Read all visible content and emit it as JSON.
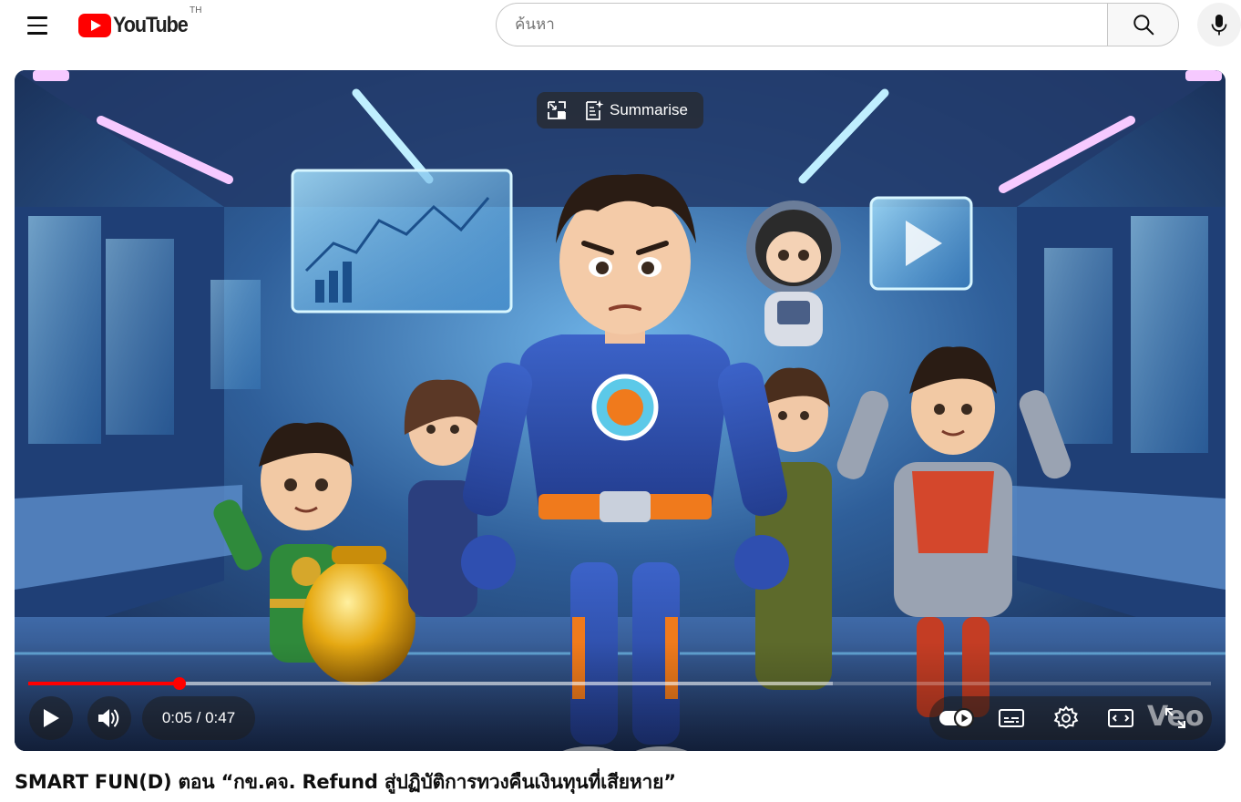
{
  "masthead": {
    "menu_icon": "hamburger-icon",
    "logo_text": "YouTube",
    "country_code": "TH",
    "brand_color": "#ff0000",
    "search_placeholder": "ค้นหา",
    "search_icon": "search-icon",
    "mic_icon": "microphone-icon"
  },
  "player": {
    "summarise_label": "Summarise",
    "miniplayer_icon": "miniplayer-icon",
    "summarise_icon": "summarise-sparkle-icon",
    "current_time": "0:05",
    "duration": "0:47",
    "time_display": "0:05 / 0:47",
    "progress_played_fraction": 0.128,
    "progress_buffered_fraction": 0.68,
    "progress_color": "#ff0000",
    "autoplay_on": true,
    "watermark": "Veo",
    "controls": {
      "play_icon": "play-icon",
      "volume_icon": "volume-icon",
      "autoplay_icon": "autoplay-toggle-icon",
      "subtitles_icon": "subtitles-icon",
      "settings_icon": "gear-icon",
      "theater_icon": "theater-mode-icon",
      "fullscreen_icon": "fullscreen-icon"
    }
  },
  "video": {
    "title": "SMART FUN(D) ตอน “กข.คจ. Refund สู่ปฏิบัติการทวงคืนเงินทุนที่เสียหาย”"
  }
}
